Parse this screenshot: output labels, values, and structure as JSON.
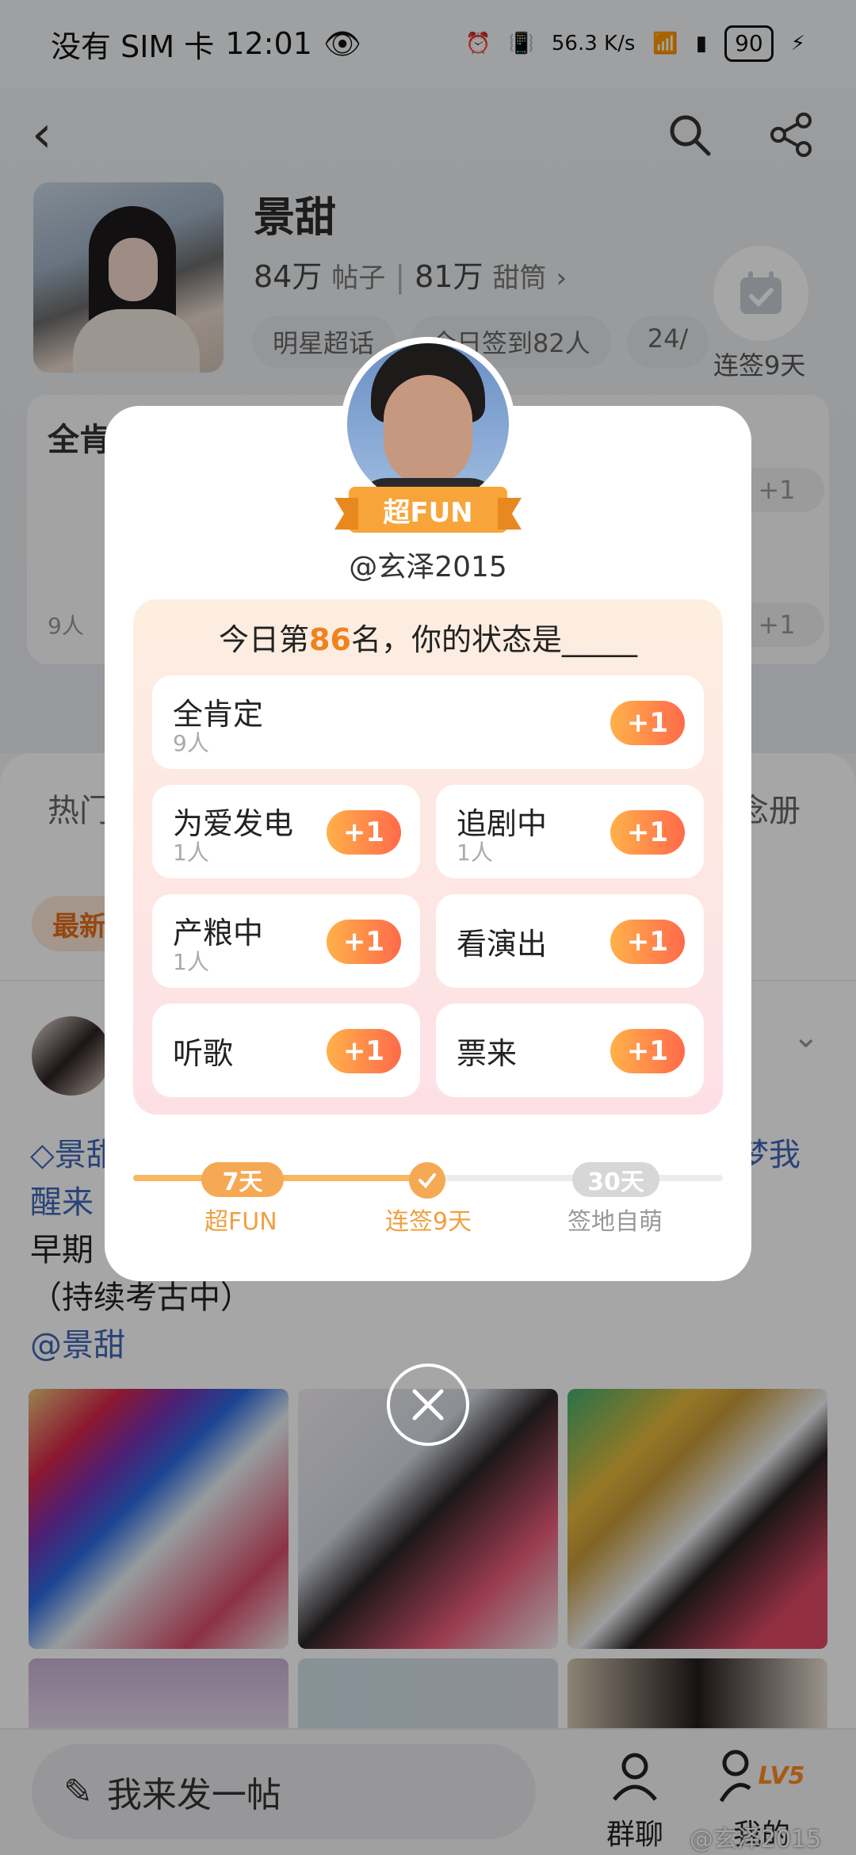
{
  "status_bar": {
    "carrier": "没有 SIM 卡",
    "time": "12:01",
    "net_speed": "56.3 K/s",
    "battery": "90"
  },
  "supertopic": {
    "name": "景甜",
    "posts_count": "84万",
    "posts_label": "帖子",
    "fans_count": "81万",
    "fans_label": "甜筒",
    "tags": [
      "明星超话",
      "今日签到82人",
      "24/"
    ],
    "checkin_label": "连签9天"
  },
  "behind_card": {
    "title": "全肯",
    "plus": "+1",
    "count": "9人"
  },
  "feed": {
    "tab_left": "热门",
    "tab_right": "念册",
    "pill_new": "最新",
    "post_lines": [
      "景甜",
      "醒来",
      "早期",
      "（持续考古中）"
    ],
    "post_right": "梦我",
    "mention": "@景甜"
  },
  "bottom_bar": {
    "post_placeholder": "我来发一帖",
    "group_chat": "群聊",
    "mine": "我的",
    "level": "LV5",
    "watermark": "@玄泽2015"
  },
  "modal": {
    "badge": "超FUN",
    "username": "@玄泽2015",
    "title_prefix": "今日第",
    "rank": "86",
    "title_suffix": "名，你的状态是_____",
    "options": [
      {
        "name": "全肯定",
        "count": "9人",
        "plus": "+1"
      },
      {
        "name": "为爱发电",
        "count": "1人",
        "plus": "+1"
      },
      {
        "name": "追剧中",
        "count": "1人",
        "plus": "+1"
      },
      {
        "name": "产粮中",
        "count": "1人",
        "plus": "+1"
      },
      {
        "name": "看演出",
        "count": "",
        "plus": "+1"
      },
      {
        "name": "听歌",
        "count": "",
        "plus": "+1"
      },
      {
        "name": "票来",
        "count": "",
        "plus": "+1"
      }
    ],
    "progress": {
      "milestones": [
        {
          "badge": "7天",
          "label": "超FUN"
        },
        {
          "badge": "",
          "label": "连签9天"
        },
        {
          "badge": "30天",
          "label": "签地自萌"
        }
      ],
      "current_days": 9,
      "max_days": 30,
      "accent": "#f5a955",
      "inactive": "#d7d7d7"
    }
  }
}
